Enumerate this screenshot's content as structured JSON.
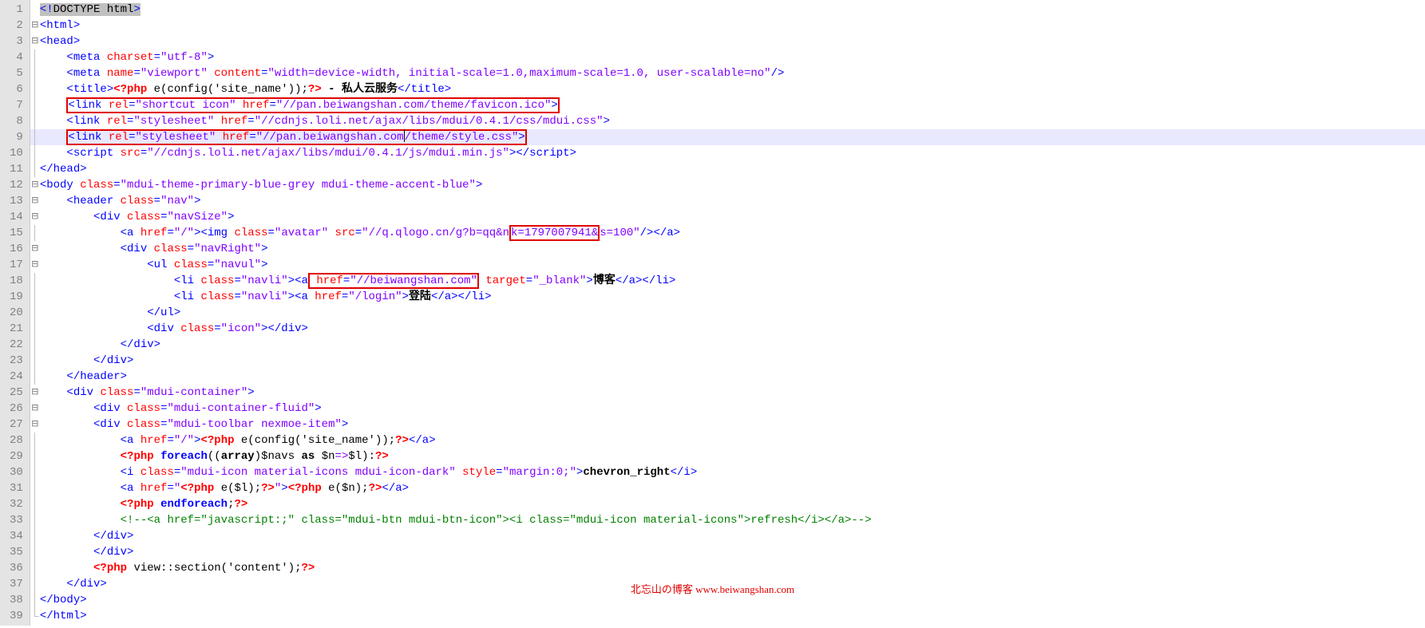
{
  "gutter": [
    "1",
    "2",
    "3",
    "4",
    "5",
    "6",
    "7",
    "8",
    "9",
    "10",
    "11",
    "12",
    "13",
    "14",
    "15",
    "16",
    "17",
    "18",
    "19",
    "20",
    "21",
    "22",
    "23",
    "24",
    "25",
    "26",
    "27",
    "28",
    "29",
    "30",
    "31",
    "32",
    "33",
    "34",
    "35",
    "36",
    "37",
    "38",
    "39"
  ],
  "fold": {
    "minus": "⊟"
  },
  "c": {
    "l1_a": "<!",
    "l1_b": "DOCTYPE html",
    "l1_c": ">",
    "l2": "<html>",
    "l3": "<head>",
    "l4_a": "    <meta ",
    "l4_b": "charset",
    "l4_c": "=",
    "l4_d": "\"utf-8\"",
    "l4_e": ">",
    "l5_a": "    <meta ",
    "l5_b1": "name",
    "l5_c": "=",
    "l5_d1": "\"viewport\"",
    "l5_sp": " ",
    "l5_b2": "content",
    "l5_d2": "\"width=device-width, initial-scale=1.0,maximum-scale=1.0, user-scalable=no\"",
    "l5_e": "/>",
    "l6_a": "    <title>",
    "l6_b": "<?php",
    "l6_sp": " ",
    "l6_c": "e(config(",
    "l6_d": "'site_name'",
    "l6_e": "));",
    "l6_f": "?>",
    "l6_g": " - 私人云服务",
    "l6_h": "</title>",
    "l7_a": "    ",
    "l7_b": "<link ",
    "l7_c": "rel",
    "l7_d": "=",
    "l7_e": "\"shortcut icon\"",
    "l7_sp": " ",
    "l7_f": "href",
    "l7_g": "\"//pan.beiwangshan.com/theme/favicon.ico\"",
    "l7_h": ">",
    "l8_a": "    <link ",
    "l8_b1": "rel",
    "l8_c": "=",
    "l8_d1": "\"stylesheet\"",
    "l8_sp": " ",
    "l8_b2": "href",
    "l8_d2": "\"//cdnjs.loli.net/ajax/libs/mdui/0.4.1/css/mdui.css\"",
    "l8_e": ">",
    "l9_a": "    ",
    "l9_b": "<link ",
    "l9_c": "rel",
    "l9_d": "=",
    "l9_e": "\"stylesheet\"",
    "l9_sp": " ",
    "l9_f": "href",
    "l9_g": "\"//pan.beiwangshan.com",
    "l9_g2": "/theme/style.css\"",
    "l9_h": ">",
    "l10_a": "    <script ",
    "l10_b": "src",
    "l10_c": "=",
    "l10_d": "\"//cdnjs.loli.net/ajax/libs/mdui/0.4.1/js/mdui.min.js\"",
    "l10_e": ">",
    "l10_f": "</script>",
    "l11": "</head>",
    "l12_a": "<body ",
    "l12_b": "class",
    "l12_c": "=",
    "l12_d": "\"mdui-theme-primary-blue-grey mdui-theme-accent-blue\"",
    "l12_e": ">",
    "l13_a": "    <header ",
    "l13_b": "class",
    "l13_c": "=",
    "l13_d": "\"nav\"",
    "l13_e": ">",
    "l14_a": "        <div ",
    "l14_b": "class",
    "l14_c": "=",
    "l14_d": "\"navSize\"",
    "l14_e": ">",
    "l15_a": "            <a ",
    "l15_b": "href",
    "l15_c": "=",
    "l15_d": "\"/\"",
    "l15_e": "><img ",
    "l15_b2": "class",
    "l15_d2": "\"avatar\"",
    "l15_sp": " ",
    "l15_b3": "src",
    "l15_d3a": "\"//q.qlogo.cn/g?b=qq&n",
    "l15_d3b": "k=1797007941&",
    "l15_d3c": "s=100\"",
    "l15_e2": "/></a>",
    "l16_a": "            <div ",
    "l16_b": "class",
    "l16_c": "=",
    "l16_d": "\"navRight\"",
    "l16_e": ">",
    "l17_a": "                <ul ",
    "l17_b": "class",
    "l17_c": "=",
    "l17_d": "\"navul\"",
    "l17_e": ">",
    "l18_a": "                    <li ",
    "l18_b": "class",
    "l18_c": "=",
    "l18_d": "\"navli\"",
    "l18_e": "><a",
    "l18_sp": " ",
    "l18_b2": "href",
    "l18_d2": "\"//beiwangshan.com\"",
    "l18_sp2": " ",
    "l18_b3": "target",
    "l18_d3": "\"_blank\"",
    "l18_e2": ">",
    "l18_t": "博客",
    "l18_e3": "</a></li>",
    "l19_a": "                    <li ",
    "l19_b": "class",
    "l19_c": "=",
    "l19_d": "\"navli\"",
    "l19_e": "><a ",
    "l19_b2": "href",
    "l19_d2": "\"/login\"",
    "l19_e2": ">",
    "l19_t": "登陆",
    "l19_e3": "</a></li>",
    "l20": "                </ul>",
    "l21_a": "                <div ",
    "l21_b": "class",
    "l21_c": "=",
    "l21_d": "\"icon\"",
    "l21_e": "></div>",
    "l22": "            </div>",
    "l23": "        </div>",
    "l24": "    </header>",
    "l25_a": "    <div ",
    "l25_b": "class",
    "l25_c": "=",
    "l25_d": "\"mdui-container\"",
    "l25_e": ">",
    "l26_a": "        <div ",
    "l26_b": "class",
    "l26_c": "=",
    "l26_d": "\"mdui-container-fluid\"",
    "l26_e": ">",
    "l27_a": "        <div ",
    "l27_b": "class",
    "l27_c": "=",
    "l27_d": "\"mdui-toolbar nexmoe-item\"",
    "l27_e": ">",
    "l28_a": "            <a ",
    "l28_b": "href",
    "l28_c": "=",
    "l28_d": "\"/\"",
    "l28_e": ">",
    "l28_f": "<?php",
    "l28_sp": " ",
    "l28_g": "e(config(",
    "l28_h": "'site_name'",
    "l28_i": "));",
    "l28_j": "?>",
    "l28_k": "</a>",
    "l29_a": "            ",
    "l29_b": "<?php",
    "l29_sp": " ",
    "l29_c": "foreach",
    "l29_d": "((",
    "l29_e": "array",
    "l29_f": ")$navs ",
    "l29_g": "as",
    "l29_h": " $n",
    "l29_i": "=>",
    "l29_j": "$l):",
    "l29_k": "?>",
    "l30_a": "            <i ",
    "l30_b": "class",
    "l30_c": "=",
    "l30_d": "\"mdui-icon material-icons mdui-icon-dark\"",
    "l30_sp": " ",
    "l30_b2": "style",
    "l30_d2": "\"margin:0;\"",
    "l30_e": ">",
    "l30_t": "chevron_right",
    "l30_e2": "</i>",
    "l31_a": "            <a ",
    "l31_b": "href",
    "l31_c": "=",
    "l31_d": "\"",
    "l31_e": "<?php",
    "l31_sp": " ",
    "l31_f": "e($l);",
    "l31_g": "?>",
    "l31_h": "\"",
    "l31_i": ">",
    "l31_j": "<?php",
    "l31_k": "e($n);",
    "l31_l": "?>",
    "l31_m": "</a>",
    "l32_a": "            ",
    "l32_b": "<?php",
    "l32_sp": " ",
    "l32_c": "endforeach",
    "l32_d": ";",
    "l32_e": "?>",
    "l33_a": "            ",
    "l33_b": "<!--<a href=\"javascript:;\" class=\"mdui-btn mdui-btn-icon\"><i class=\"mdui-icon material-icons\">refresh</i></a>-->",
    "l34": "        </div>",
    "l35": "        </div>",
    "l36_a": "        ",
    "l36_b": "<?php",
    "l36_sp": " ",
    "l36_c": "view::section(",
    "l36_d": "'content'",
    "l36_e": ");",
    "l36_f": "?>",
    "l37": "    </div>",
    "l38": "</body>",
    "l39": "</html>"
  },
  "watermark": "北忘山の博客 www.beiwangshan.com"
}
